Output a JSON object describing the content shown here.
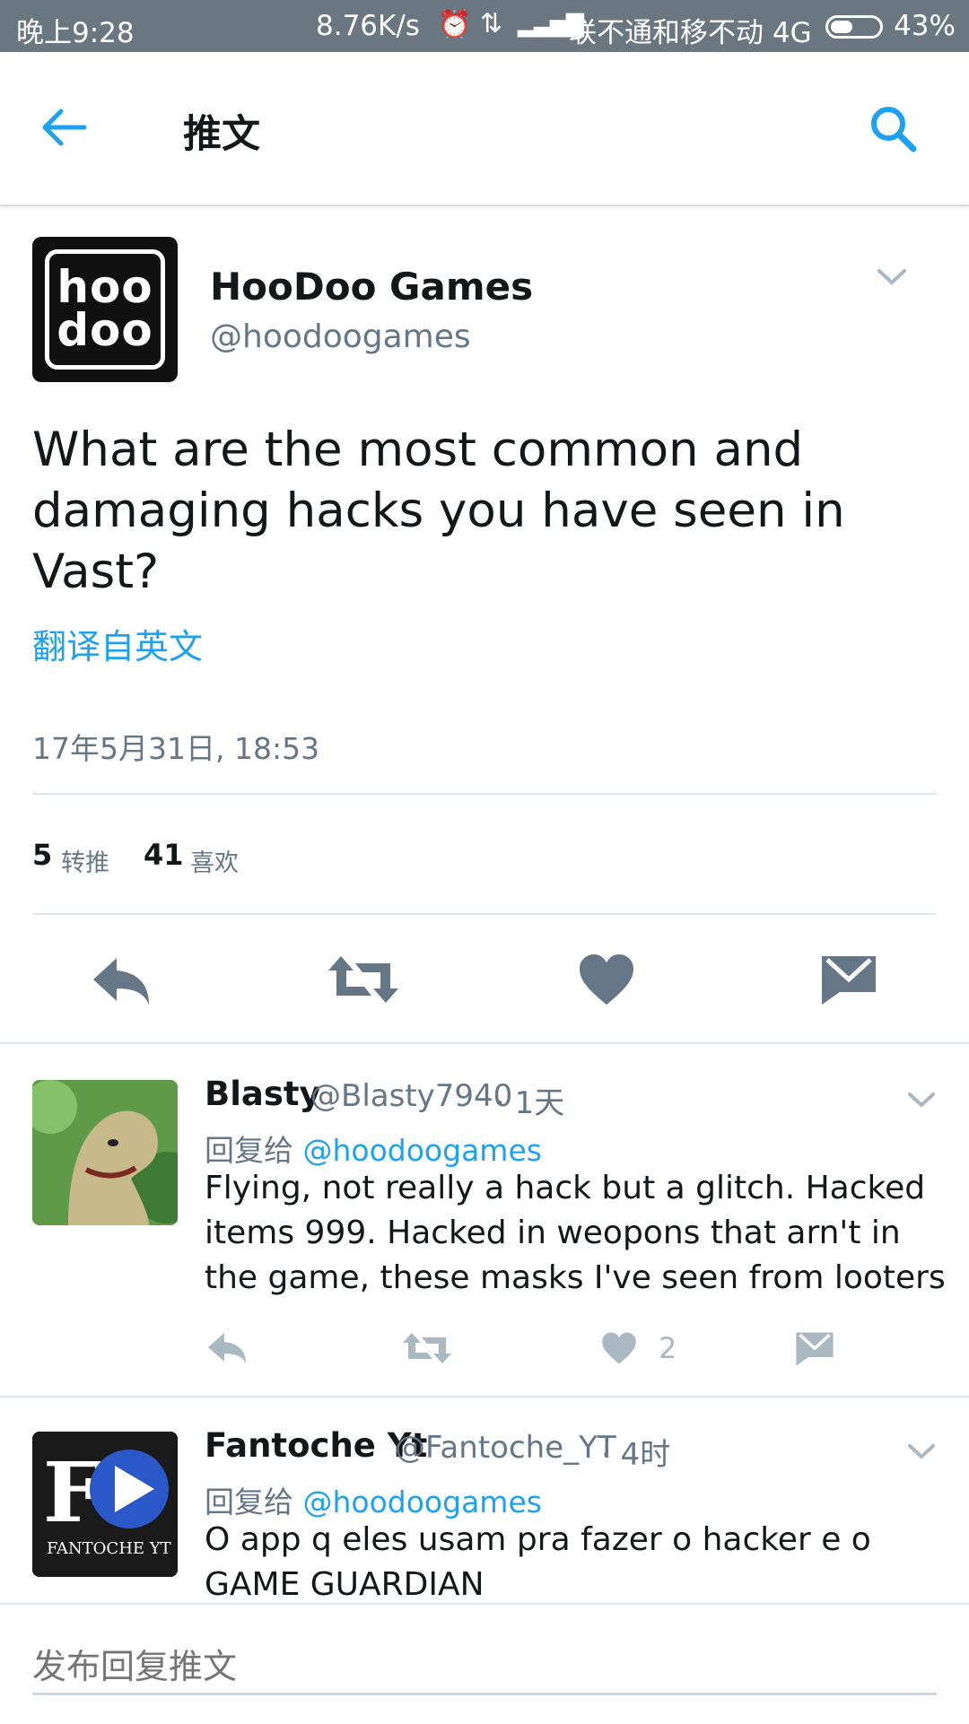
{
  "status_bar": {
    "time": "晚上9:28",
    "speed": "8.76K/s",
    "carrier": "联不通和移不动 4G",
    "battery": "43%"
  },
  "header": {
    "title": "推文",
    "back_icon": "back-arrow-icon",
    "search_icon": "search-icon"
  },
  "tweet": {
    "author_name": "HooDoo Games",
    "author_handle": "@hoodoogames",
    "avatar_text": "hoo doo",
    "text": "What are the most common and damaging hacks you have seen in Vast?",
    "translate": "翻译自英文",
    "timestamp": "17年5月31日, 18:53",
    "retweets_count": "5",
    "retweets_label": "转推",
    "likes_count": "41",
    "likes_label": "喜欢"
  },
  "actions": [
    "reply-icon",
    "retweet-icon",
    "like-icon",
    "direct-message-icon"
  ],
  "replies": [
    {
      "name": "Blasty",
      "handle": "@Blasty7940",
      "time": "· 1天",
      "reply_to_label": "回复给",
      "reply_to_handle": "@hoodoogames",
      "text": "Flying, not really a hack but a glitch. Hacked items 999. Hacked in weopons that arn't in the game, these masks I've seen from looters",
      "likes": "2"
    },
    {
      "name": "Fantoche Yt",
      "handle": "@Fantoche_YT",
      "time": "· 4时",
      "reply_to_label": "回复给",
      "reply_to_handle": "@hoodoogames",
      "text": "O app q eles usam pra fazer o hacker e o GAME GUARDIAN",
      "avatar_text": "FANTOCHE YT"
    }
  ],
  "compose": {
    "placeholder": "发布回复推文"
  },
  "colors": {
    "accent": "#1da1f2",
    "status_bar": "#6b7780",
    "secondary_text": "#657786",
    "icon_gray": "#657786"
  }
}
